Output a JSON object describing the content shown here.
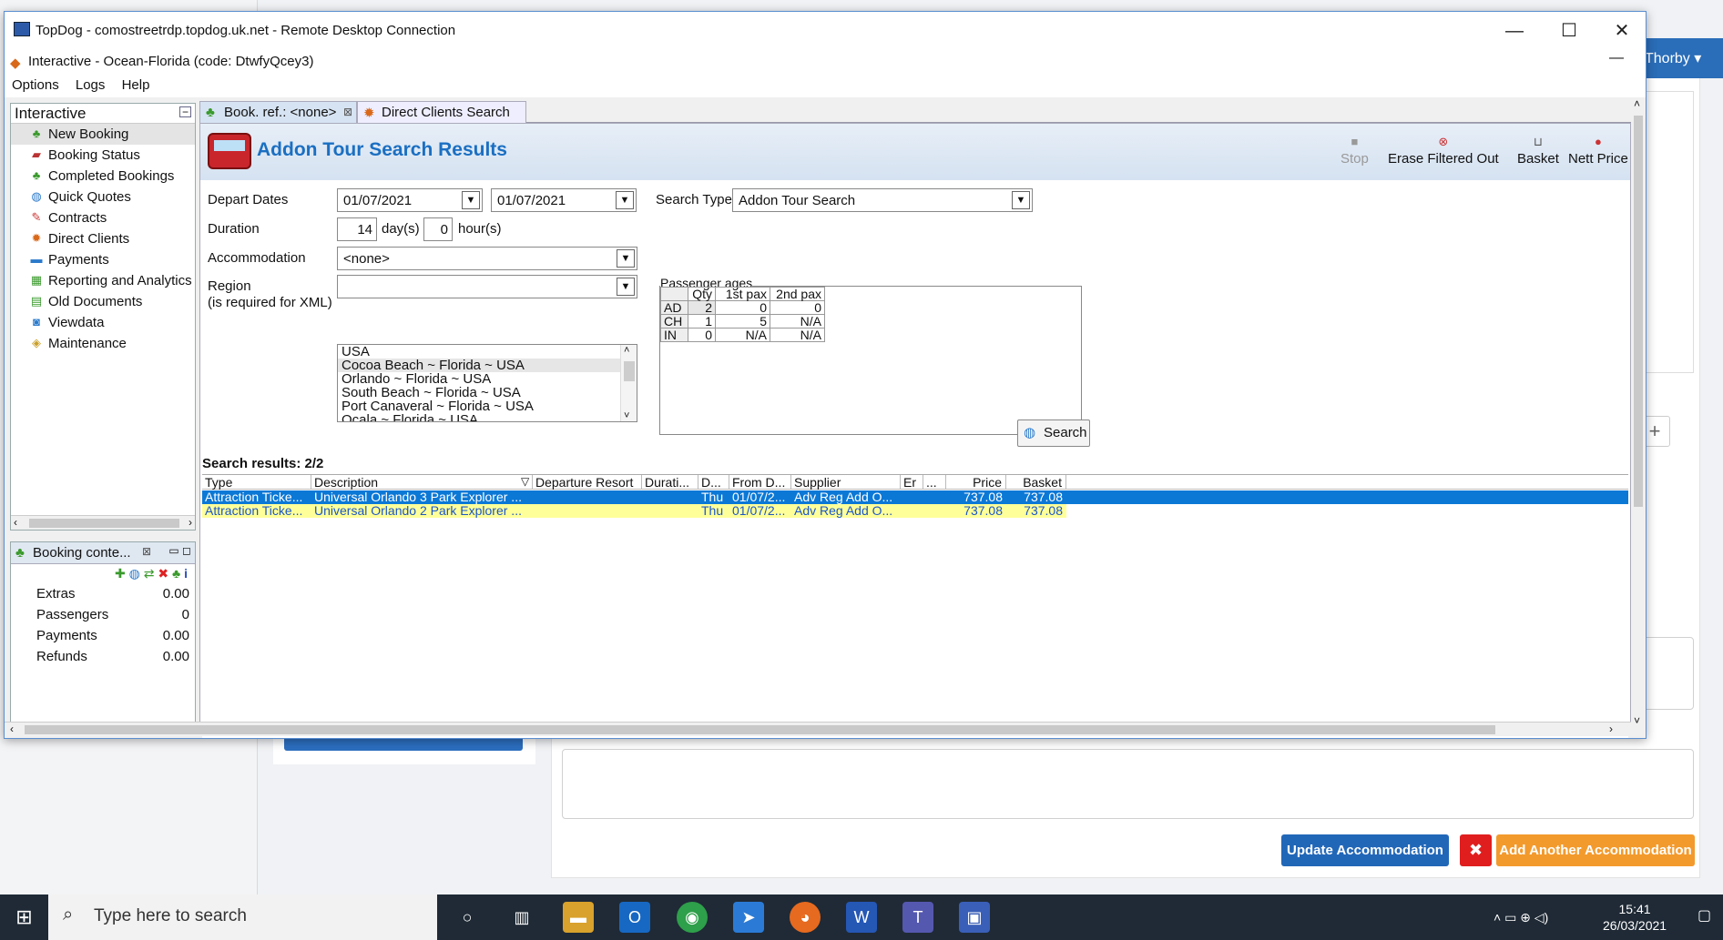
{
  "background": {
    "user_partial": "Thorby",
    "buttons": {
      "update": "Update Accommodation",
      "remove": "✖",
      "add_another": "Add Another Accommodation"
    }
  },
  "rdp": {
    "title": "TopDog - comostreetrdp.topdog.uk.net - Remote Desktop Connection"
  },
  "app": {
    "title": "Interactive - Ocean-Florida (code: DtwfyQcey3)",
    "menu": [
      "Options",
      "Logs",
      "Help"
    ]
  },
  "nav": {
    "header": "Interactive",
    "items": [
      "New Booking",
      "Booking Status",
      "Completed Bookings",
      "Quick Quotes",
      "Contracts",
      "Direct Clients",
      "Payments",
      "Reporting and Analytics",
      "Old Documents",
      "Viewdata",
      "Maintenance"
    ]
  },
  "booking": {
    "tab": "Booking conte...",
    "rows": [
      {
        "label": "Extras",
        "value": "0.00"
      },
      {
        "label": "Passengers",
        "value": "0"
      },
      {
        "label": "Payments",
        "value": "0.00"
      },
      {
        "label": "Refunds",
        "value": "0.00"
      }
    ]
  },
  "tabs": [
    "Book. ref.: <none>",
    "Direct Clients Search"
  ],
  "main": {
    "title": "Addon Tour Search Results",
    "toolbar": [
      "Stop",
      "Erase Filtered Out",
      "Basket",
      "Nett Price"
    ],
    "form": {
      "depart_label": "Depart Dates",
      "depart_from": "01/07/2021",
      "depart_to": "01/07/2021",
      "duration_label": "Duration",
      "duration_days": "14",
      "days_unit": "day(s)",
      "duration_hours": "0",
      "hours_unit": "hour(s)",
      "accommodation_label": "Accommodation",
      "accommodation_value": "<none>",
      "region_label": "Region",
      "region_note": "(is required for XML)",
      "regions": [
        "USA",
        "Cocoa Beach ~ Florida ~ USA",
        "Orlando ~ Florida ~ USA",
        "South Beach ~ Florida ~ USA",
        "Port Canaveral ~ Florida ~ USA",
        "Ocala ~ Florida ~ USA"
      ],
      "search_type_label": "Search Type",
      "search_type_value": "Addon Tour Search",
      "pax_label": "Passenger ages",
      "pax_headers": [
        "",
        "Qty",
        "1st pax",
        "2nd pax"
      ],
      "pax_rows": [
        [
          "AD",
          "2",
          "0",
          "0"
        ],
        [
          "CH",
          "1",
          "5",
          "N/A"
        ],
        [
          "IN",
          "0",
          "N/A",
          "N/A"
        ]
      ],
      "search_button": "Search"
    },
    "results_label": "Search results: 2/2",
    "columns": [
      "Type",
      "Description",
      "Departure Resort",
      "Durati...",
      "D...",
      "From D...",
      "Supplier",
      "Er",
      "...",
      "Price",
      "Basket"
    ],
    "rows": [
      [
        "Attraction Ticke...",
        "Universal Orlando 3 Park Explorer ...",
        "",
        "",
        "Thu",
        "01/07/2...",
        "Adv Reg Add O...",
        "",
        "",
        "737.08",
        "737.08"
      ],
      [
        "Attraction Ticke...",
        "Universal Orlando 2 Park Explorer ...",
        "",
        "",
        "Thu",
        "01/07/2...",
        "Adv Reg Add O...",
        "",
        "",
        "737.08",
        "737.08"
      ]
    ]
  },
  "taskbar": {
    "search_placeholder": "Type here to search",
    "time": "15:41",
    "date": "26/03/2021"
  }
}
